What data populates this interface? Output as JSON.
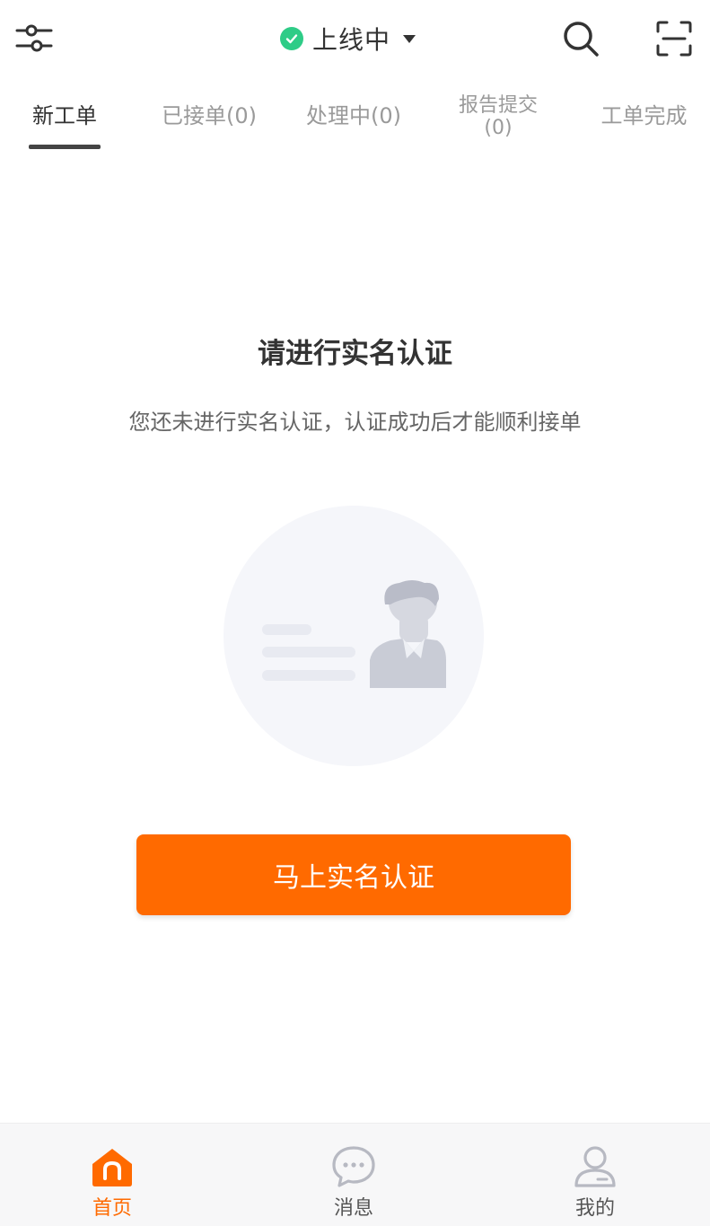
{
  "header": {
    "status_label": "上线中",
    "status_color": "#2ecc87",
    "icons": {
      "filter": "filter-sliders-icon",
      "search": "search-icon",
      "scan": "scan-icon",
      "status": "check-circle-icon",
      "dropdown": "caret-down-icon"
    }
  },
  "tabs": [
    {
      "label": "新工单",
      "active": true
    },
    {
      "label": "已接单(0)"
    },
    {
      "label": "处理中(0)"
    },
    {
      "label_line1": "报告提交",
      "label_line2": "(0)"
    },
    {
      "label": "工单完成"
    }
  ],
  "main": {
    "title": "请进行实名认证",
    "description": "您还未进行实名认证，认证成功后才能顺利接单",
    "cta_label": "马上实名认证",
    "illustration": "id-card-person-illustration"
  },
  "bottom_nav": [
    {
      "label": "首页",
      "icon": "home-icon",
      "active": true
    },
    {
      "label": "消息",
      "icon": "message-icon"
    },
    {
      "label": "我的",
      "icon": "user-icon"
    }
  ],
  "colors": {
    "accent": "#ff6a00",
    "text_primary": "#333333",
    "text_muted": "#9a9a9a",
    "nav_background": "#f7f7f8"
  }
}
